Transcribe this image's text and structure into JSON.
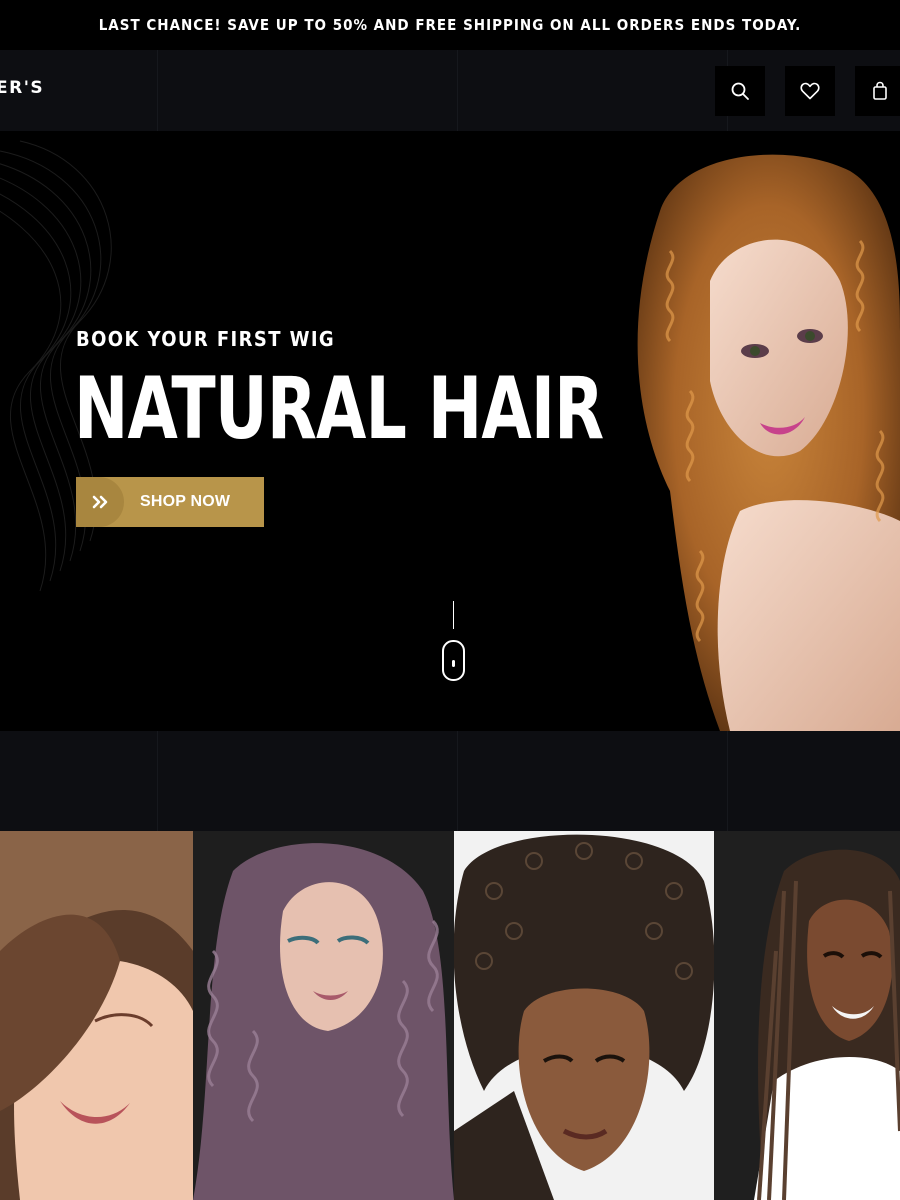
{
  "announcement": {
    "text": "LAST CHANCE! SAVE UP TO 50% AND FREE SHIPPING ON ALL ORDERS ENDS TODAY."
  },
  "header": {
    "logo_text": "ER'S",
    "icons": [
      "search-icon",
      "heart-icon",
      "shopping-bag-icon"
    ]
  },
  "hero": {
    "kicker": "BOOK YOUR FIRST WIG",
    "headline": "NATURAL HAIR",
    "cta_label": "SHOP NOW",
    "cta_icon": "double-chevron-right-icon",
    "scroll_indicator": "mouse-scroll-icon"
  },
  "colors": {
    "accent": "#b8954a",
    "header_bg": "#0d0e12",
    "hero_bg": "#000000"
  },
  "category_tiles": [
    {
      "subject": "woman-brown-hair-photo"
    },
    {
      "subject": "woman-purple-wavy-hair-photo"
    },
    {
      "subject": "woman-curly-afro-hair-photo"
    },
    {
      "subject": "woman-braided-hair-photo"
    }
  ]
}
